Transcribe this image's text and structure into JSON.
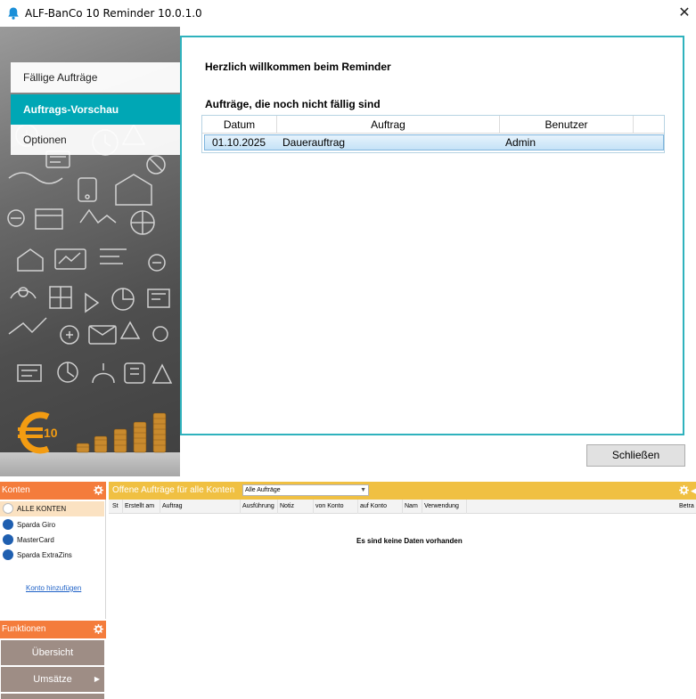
{
  "window": {
    "title": "ALF-BanCo 10 Reminder 10.0.1.0",
    "close_glyph": "✕"
  },
  "nav": {
    "items": [
      {
        "label": "Fällige Aufträge",
        "active": false
      },
      {
        "label": "Auftrags-Vorschau",
        "active": true
      },
      {
        "label": "Optionen",
        "active": false
      }
    ]
  },
  "main": {
    "welcome": "Herzlich willkommen beim Reminder",
    "section_title": "Aufträge, die noch nicht fällig sind",
    "columns": [
      "Datum",
      "Auftrag",
      "Benutzer"
    ],
    "rows": [
      {
        "datum": "01.10.2025",
        "auftrag": "Dauerauftrag",
        "benutzer": "Admin",
        "selected": true
      }
    ],
    "close_button": "Schließen"
  },
  "logo": {
    "digits": "10",
    "symbol": "€"
  },
  "bottom": {
    "konten": {
      "header": "Konten",
      "items": [
        {
          "label": "ALLE KONTEN",
          "active": true
        },
        {
          "label": "Sparda Giro",
          "active": false
        },
        {
          "label": "MasterCard",
          "active": false
        },
        {
          "label": "Sparda ExtraZins",
          "active": false
        }
      ],
      "add_link": "Konto hinzufügen"
    },
    "funktionen": {
      "header": "Funktionen",
      "buttons": [
        {
          "label": "Übersicht",
          "has_arrow": false
        },
        {
          "label": "Umsätze",
          "has_arrow": true
        }
      ],
      "arrow_glyph": "▶"
    },
    "orders": {
      "header": "Offene Aufträge für alle Konten",
      "filter_value": "Alle Aufträge",
      "more_glyph": "◀",
      "columns": [
        "St",
        "Erstellt am",
        "Auftrag",
        "Ausführung",
        "Notiz",
        "von Konto",
        "auf Konto",
        "Nam",
        "Verwendung",
        "Betra"
      ],
      "empty_message": "Es sind keine Daten vorhanden"
    }
  },
  "colors": {
    "accent_teal": "#00a7b5",
    "content_border": "#2fb2bd",
    "orange": "#f47c3c",
    "yellow": "#f0c042",
    "function_button": "#9e8d85"
  }
}
